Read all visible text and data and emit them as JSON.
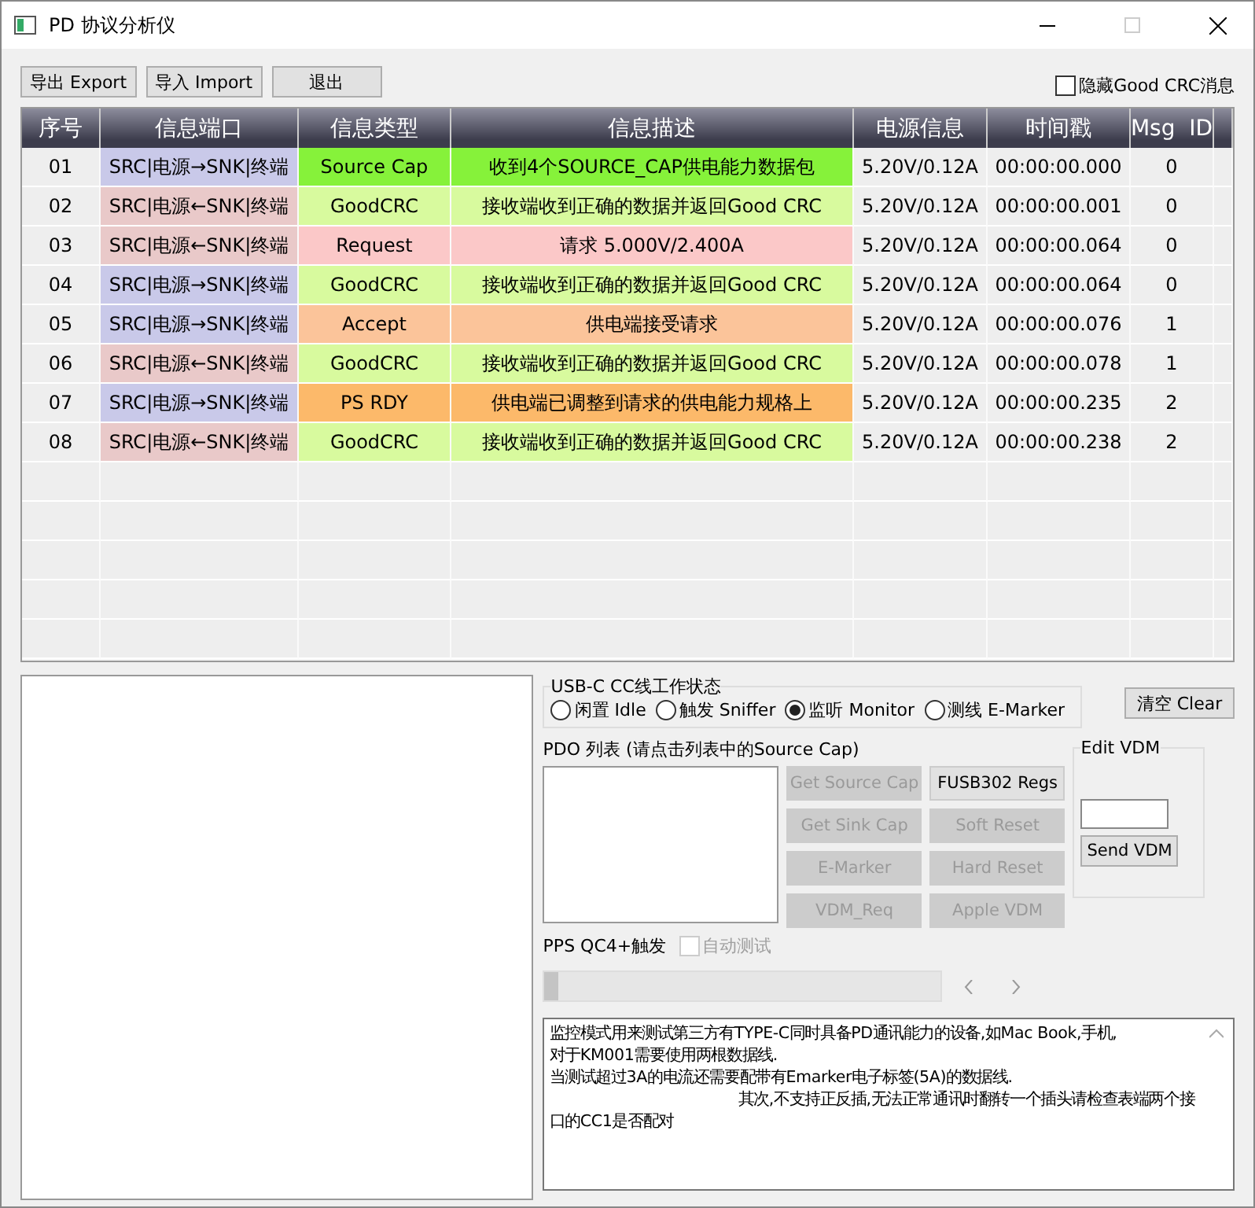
{
  "window": {
    "title": "PD 协议分析仪"
  },
  "toolbar": {
    "buttons": [
      "导出 Export",
      "导入 Import",
      "退出"
    ],
    "hide_goodcrc": {
      "label": "隐藏Good CRC消息",
      "checked": false
    }
  },
  "table": {
    "columns": [
      "序号",
      "信息端口",
      "信息类型",
      "信息描述",
      "电源信息",
      "时间戳",
      "Msg  ID"
    ],
    "rows": [
      {
        "no": "01",
        "port": {
          "text": "SRC|电源→SNK|终端",
          "color": "#c9c9e9"
        },
        "type": "Source Cap",
        "color": "#86f23a",
        "description": "收到4个SOURCE_CAP供电能力数据包",
        "power": "5.20V/0.12A",
        "time": "00:00:00.000",
        "msg_id": "0"
      },
      {
        "no": "02",
        "port": {
          "text": "SRC|电源←SNK|终端",
          "color": "#e9c9c9"
        },
        "type": "GoodCRC",
        "color": "#d8fa9e",
        "description": "接收端收到正确的数据并返回Good CRC",
        "power": "5.20V/0.12A",
        "time": "00:00:00.001",
        "msg_id": "0"
      },
      {
        "no": "03",
        "port": {
          "text": "SRC|电源←SNK|终端",
          "color": "#e9c9c9"
        },
        "type": "Request",
        "color": "#fbc8c8",
        "description": "请求 5.000V/2.400A",
        "power": "5.20V/0.12A",
        "time": "00:00:00.064",
        "msg_id": "0"
      },
      {
        "no": "04",
        "port": {
          "text": "SRC|电源→SNK|终端",
          "color": "#c9c9e9"
        },
        "type": "GoodCRC",
        "color": "#d8fa9e",
        "description": "接收端收到正确的数据并返回Good CRC",
        "power": "5.20V/0.12A",
        "time": "00:00:00.064",
        "msg_id": "0"
      },
      {
        "no": "05",
        "port": {
          "text": "SRC|电源→SNK|终端",
          "color": "#c9c9e9"
        },
        "type": "Accept",
        "color": "#fbc49a",
        "description": "供电端接受请求",
        "power": "5.20V/0.12A",
        "time": "00:00:00.076",
        "msg_id": "1"
      },
      {
        "no": "06",
        "port": {
          "text": "SRC|电源←SNK|终端",
          "color": "#e9c9c9"
        },
        "type": "GoodCRC",
        "color": "#d8fa9e",
        "description": "接收端收到正确的数据并返回Good CRC",
        "power": "5.20V/0.12A",
        "time": "00:00:00.078",
        "msg_id": "1"
      },
      {
        "no": "07",
        "port": {
          "text": "SRC|电源→SNK|终端",
          "color": "#c9c9e9"
        },
        "type": "PS RDY",
        "color": "#fcb96a",
        "description": "供电端已调整到请求的供电能力规格上",
        "power": "5.20V/0.12A",
        "time": "00:00:00.235",
        "msg_id": "2"
      },
      {
        "no": "08",
        "port": {
          "text": "SRC|电源←SNK|终端",
          "color": "#e9c9c9"
        },
        "type": "GoodCRC",
        "color": "#d8fa9e",
        "description": "接收端收到正确的数据并返回Good CRC",
        "power": "5.20V/0.12A",
        "time": "00:00:00.238",
        "msg_id": "2"
      }
    ]
  },
  "cc_state": {
    "title": "USB-C CC线工作状态",
    "options": [
      {
        "label": "闲置 Idle",
        "selected": false
      },
      {
        "label": "触发 Sniffer",
        "selected": false
      },
      {
        "label": "监听 Monitor",
        "selected": true
      },
      {
        "label": "测线 E-Marker",
        "selected": false
      }
    ]
  },
  "clear_button": "清空 Clear",
  "pdo": {
    "title": "PDO 列表 (请点击列表中的Source Cap)",
    "buttons": [
      {
        "label": "Get Source Cap",
        "disabled": true
      },
      {
        "label": "FUSB302 Regs",
        "disabled": false
      },
      {
        "label": "Get Sink Cap",
        "disabled": true
      },
      {
        "label": "Soft Reset",
        "disabled": true
      },
      {
        "label": "E-Marker",
        "disabled": true
      },
      {
        "label": "Hard Reset",
        "disabled": true
      },
      {
        "label": "VDM_Req",
        "disabled": true
      },
      {
        "label": "Apple VDM",
        "disabled": true
      }
    ]
  },
  "vdm": {
    "title": "Edit VDM",
    "button": "Send VDM"
  },
  "pps": {
    "label": "PPS QC4+触发",
    "auto_test": {
      "label": "自动测试",
      "checked": false,
      "disabled": true
    },
    "slider": {
      "level": 0
    }
  },
  "log": [
    {
      "text": "监控模式用来测试第三方有TYPE-C同时具备PD通讯能力的设备,如Mac Book,手机,",
      "indented": false
    },
    {
      "text": "对于KM001需要使用两根数据线.",
      "indented": false
    },
    {
      "text": "当测试超过3A的电流还需要配带有Emarker电子标签(5A)的数据线.",
      "indented": false
    },
    {
      "text": "其次,不支持正反插,无法正常通讯时翻转一个插头请检查表端两个接口的CC1是否配对",
      "indented": true
    }
  ]
}
